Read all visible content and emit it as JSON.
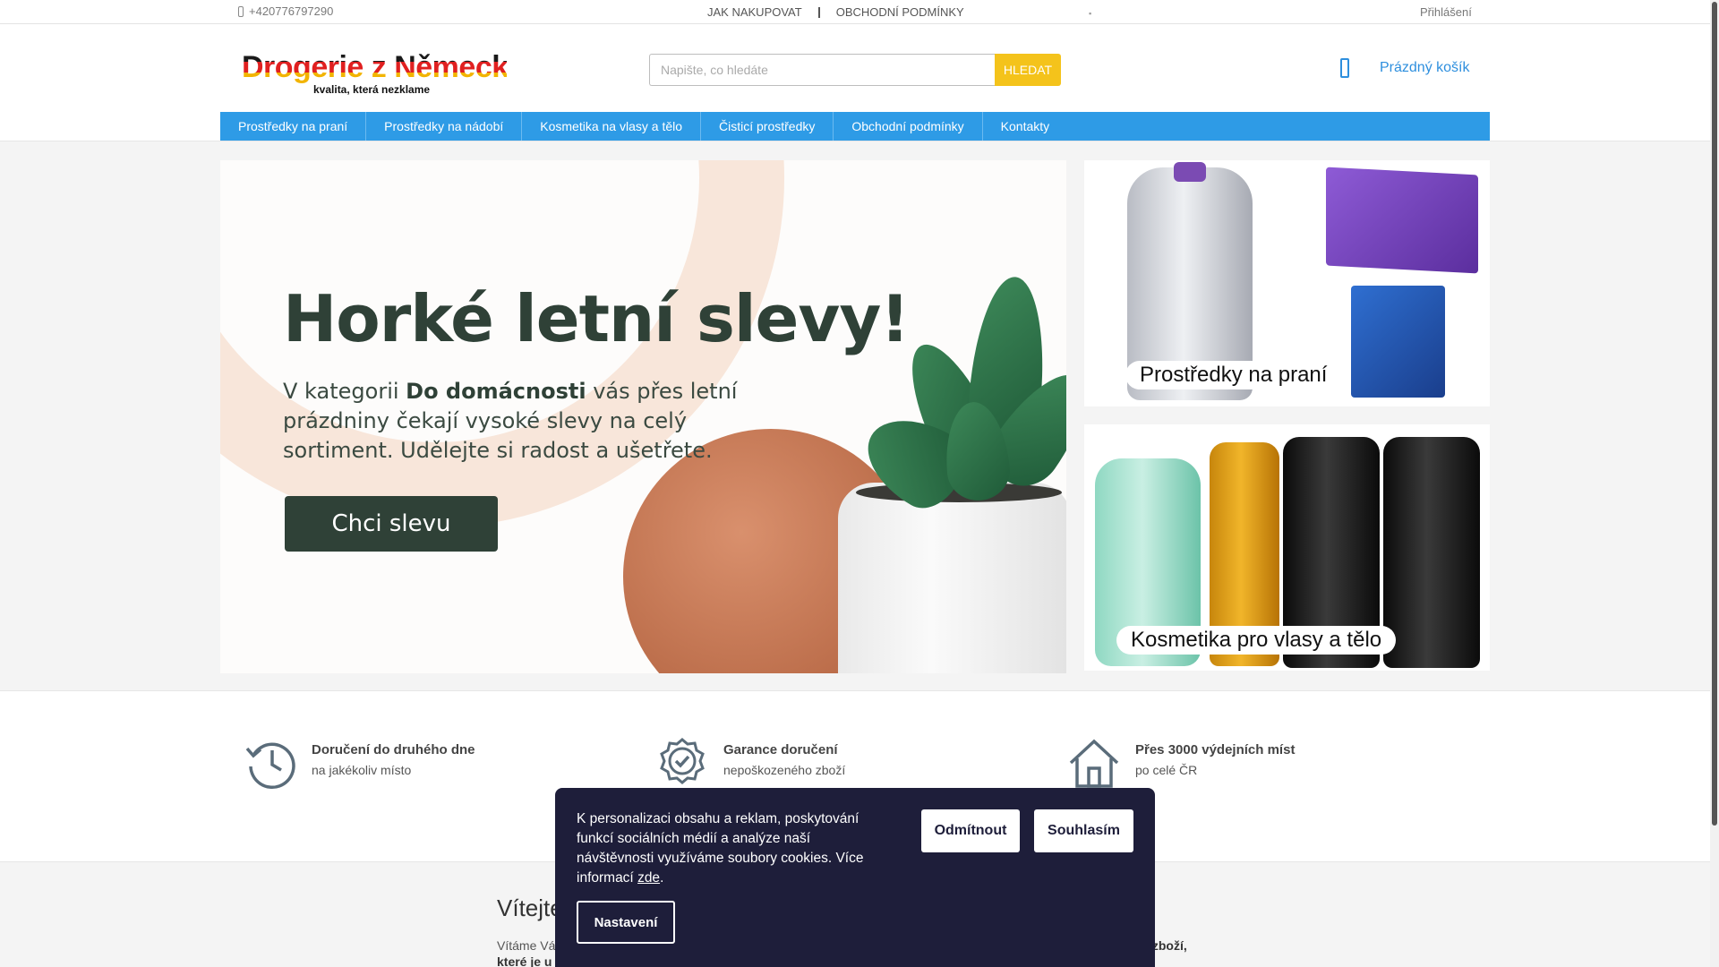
{
  "topbar": {
    "phone": "+420776797290",
    "links": [
      "JAK NAKUPOVAT",
      "OBCHODNÍ PODMÍNKY"
    ],
    "login": "Přihlášení"
  },
  "header": {
    "logo_title": "Drogerie z Německa",
    "logo_tagline": "kvalita, která nezklame",
    "search_placeholder": "Napište, co hledáte",
    "search_value": "",
    "search_button": "HLEDAT",
    "cart_label": "Prázdný košík"
  },
  "nav": {
    "items": [
      "Prostředky na praní",
      "Prostředky na nádobí",
      "Kosmetika na vlasy a tělo",
      "Čisticí prostředky",
      "Obchodní podmínky",
      "Kontakty"
    ]
  },
  "hero": {
    "title": "Horké letní slevy!",
    "text_before": "V kategorii ",
    "text_bold": "Do domácnosti",
    "text_after": " vás přes letní prázdniny čekají vysoké slevy na celý sortiment. Udělejte si radost a ušetřete.",
    "cta": "Chci slevu"
  },
  "side_banners": [
    {
      "label": "Prostředky na praní"
    },
    {
      "label": "Kosmetika pro vlasy a tělo"
    }
  ],
  "features": [
    {
      "title": "Doručení do druhého dne",
      "subtitle": "na jakékoliv místo"
    },
    {
      "title": "Garance doručení",
      "subtitle": "nepoškozeného zboží"
    },
    {
      "title": "Přes 3000 výdejních míst",
      "subtitle": "po celé ČR"
    }
  ],
  "welcome": {
    "title": "Vítejte",
    "line1": "Vítáme Vá",
    "line2": "které je u",
    "right": "ltní zboží,"
  },
  "cookie": {
    "text": "K personalizaci obsahu a reklam, poskytování funkcí sociálních médií a analýze naší návštěvnosti využíváme soubory cookies. Více informací ",
    "link": "zde",
    "text_end": ".",
    "reject": "Odmítnout",
    "accept": "Souhlasím",
    "settings": "Nastavení"
  },
  "colors": {
    "accent_blue": "#2e9be6",
    "search_button": "#f4c31b",
    "hero_dark": "#2f4137",
    "cookie_bg": "#1e1e3a"
  },
  "icons": {
    "phone": "phone-icon",
    "cart": "cart-icon",
    "delivery": "clock-history-icon",
    "guarantee": "badge-check-icon",
    "pickup": "house-icon"
  }
}
